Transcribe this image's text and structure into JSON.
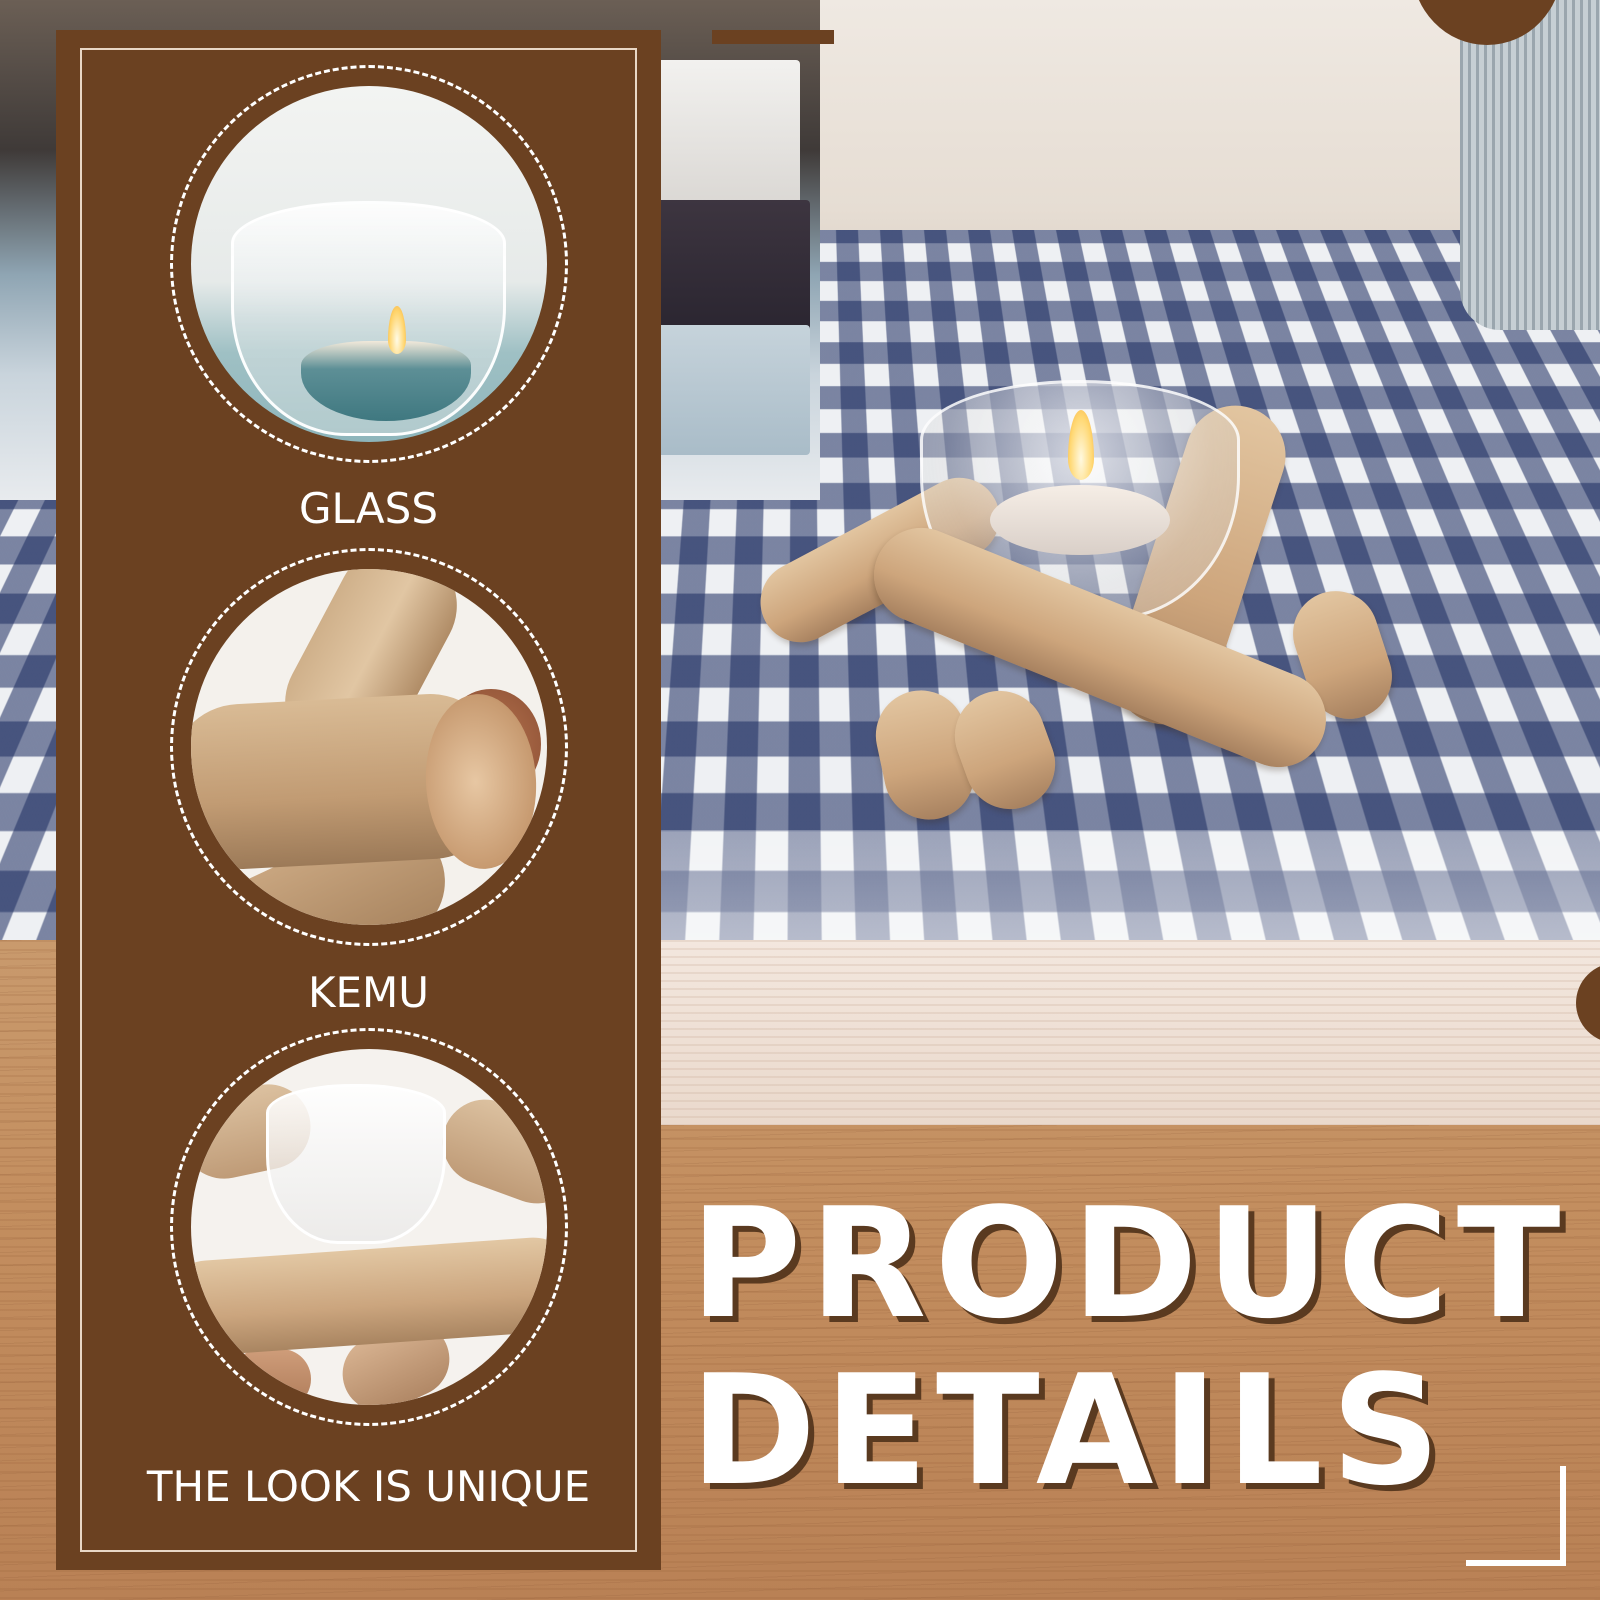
{
  "panel": {
    "features": [
      {
        "label": "GLASS",
        "image": "glass tealight cup"
      },
      {
        "label": "KEMU",
        "image": "driftwood close-up"
      },
      {
        "label": "THE LOOK IS UNIQUE",
        "image": "driftwood candle holder with glass"
      }
    ]
  },
  "title": {
    "line1": "PRODUCT",
    "line2": "DETAILS"
  },
  "colors": {
    "panel_brown": "#6b4121",
    "text_white": "#ffffff",
    "title_shadow": "#5a3a20"
  }
}
